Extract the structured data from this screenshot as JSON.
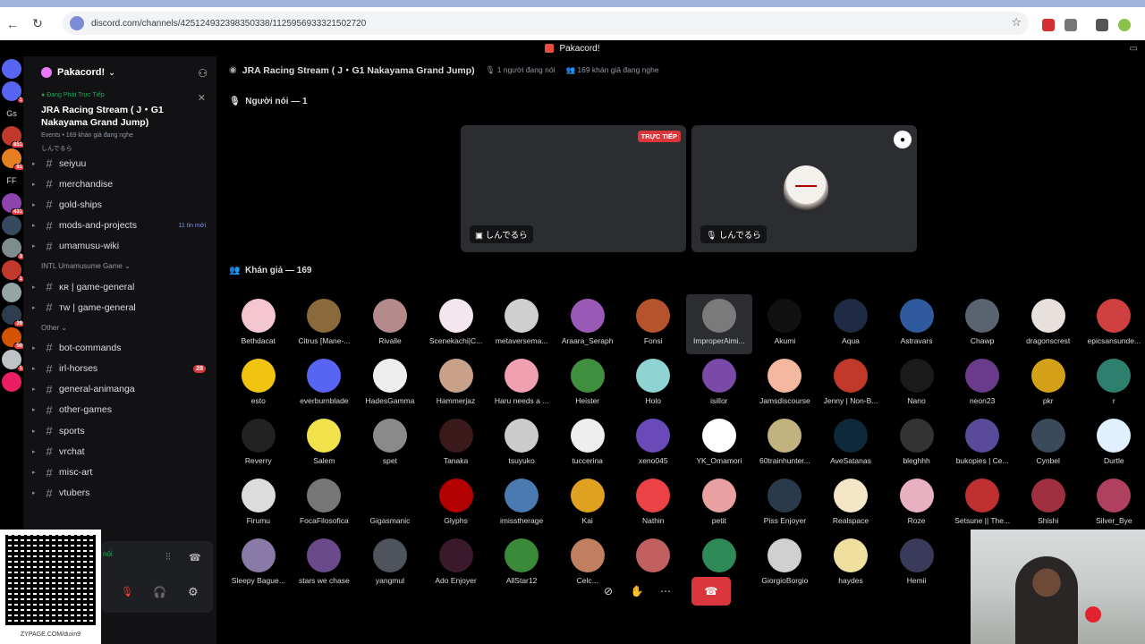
{
  "browser": {
    "url": "discord.com/channels/425124932398350338/1125956933321502720",
    "back_icon": "←",
    "reload_icon": "↻",
    "star_icon": "☆"
  },
  "window": {
    "title": "Pakacord!"
  },
  "guilds": [
    {
      "label": "",
      "color": "#5865f2",
      "badge": ""
    },
    {
      "label": "",
      "color": "#5865f2",
      "badge": "1"
    },
    {
      "label": "Gs",
      "color": "#000000",
      "badge": ""
    },
    {
      "label": "",
      "color": "#c0392b",
      "badge": "851"
    },
    {
      "label": "",
      "color": "#e67e22",
      "badge": "91"
    },
    {
      "label": "FF",
      "color": "#000000",
      "badge": ""
    },
    {
      "label": "",
      "color": "#8e44ad",
      "badge": "431"
    },
    {
      "label": "",
      "color": "#34495e",
      "badge": ""
    },
    {
      "label": "",
      "color": "#7f8c8d",
      "badge": "3"
    },
    {
      "label": "",
      "color": "#c0392b",
      "badge": "1"
    },
    {
      "label": "",
      "color": "#95a5a6",
      "badge": ""
    },
    {
      "label": "",
      "color": "#2c3e50",
      "badge": "39"
    },
    {
      "label": "",
      "color": "#d35400",
      "badge": "50"
    },
    {
      "label": "",
      "color": "#bdc3c7",
      "badge": "1"
    },
    {
      "label": "",
      "color": "#e91e63",
      "badge": ""
    }
  ],
  "server": {
    "name": "Pakacord!",
    "chevron": "⌄"
  },
  "live_event": {
    "label": "Đang Phát Trực Tiếp",
    "title": "JRA Racing Stream ( J・G1 Nakayama Grand Jump)",
    "meta": "Events • 169 khán giả đang nghe",
    "host": "しんでるら"
  },
  "channels_top": [
    {
      "name": "seiyuu",
      "badge": "",
      "badge_type": ""
    },
    {
      "name": "merchandise",
      "badge": "",
      "badge_type": ""
    },
    {
      "name": "gold-ships",
      "badge": "",
      "badge_type": ""
    },
    {
      "name": "mods-and-projects",
      "badge": "11 tin mới",
      "badge_type": "new"
    },
    {
      "name": "umamusu-wiki",
      "badge": "",
      "badge_type": ""
    }
  ],
  "category_intl": "INTL Umamusume Game",
  "channels_intl": [
    {
      "name": "ᴋʀ | game-general"
    },
    {
      "name": "ᴛᴡ | game-general"
    }
  ],
  "category_other": "Other",
  "channels_other": [
    {
      "name": "bot-commands",
      "badge": ""
    },
    {
      "name": "irl-horses",
      "badge": "28"
    },
    {
      "name": "general-animanga",
      "badge": ""
    },
    {
      "name": "other-games",
      "badge": ""
    },
    {
      "name": "sports",
      "badge": ""
    },
    {
      "name": "vrchat",
      "badge": ""
    },
    {
      "name": "misc-art",
      "badge": ""
    },
    {
      "name": "vtubers",
      "badge": ""
    }
  ],
  "user_panel": {
    "status": "nối"
  },
  "qr": {
    "caption": "ZYPAGE.COM/duxn9"
  },
  "stage": {
    "title": "JRA Racing Stream ( J・G1 Nakayama Grand Jump)",
    "speaking": "1 người đang nói",
    "listening": "169 khán giả đang nghe",
    "speakers_heading": "Người nói — 1",
    "audience_heading": "Khán giả — 169",
    "live_tag": "TRỰC TIẾP",
    "tiles": [
      {
        "name": "しんでるら"
      },
      {
        "name": "しんでるら"
      }
    ]
  },
  "audience": [
    [
      {
        "name": "Bethdacat",
        "color": "#f4c6d0"
      },
      {
        "name": "Citrus [Mane-...",
        "color": "#8a6a3a"
      },
      {
        "name": "Rivalle",
        "color": "#b48a8a"
      },
      {
        "name": "Scenekachi|C...",
        "color": "#f3e6ee"
      },
      {
        "name": "metaversema...",
        "color": "#cfcfcf"
      },
      {
        "name": "Araara_Seraph",
        "color": "#9b59b6"
      },
      {
        "name": "Fonsi",
        "color": "#b5542c"
      },
      {
        "name": "ImproperAimi...",
        "color": "#7a7a7a"
      },
      {
        "name": "Akumi",
        "color": "#111111"
      },
      {
        "name": "Aqua",
        "color": "#1f2a44"
      },
      {
        "name": "Astravars",
        "color": "#2f5a9e"
      },
      {
        "name": "Chawp",
        "color": "#5a6470"
      },
      {
        "name": "dragonscrest",
        "color": "#e8e0dc"
      },
      {
        "name": "epicsansunde...",
        "color": "#d04040"
      }
    ],
    [
      {
        "name": "esto",
        "color": "#f1c40f"
      },
      {
        "name": "everburnblade",
        "color": "#5865f2"
      },
      {
        "name": "HadesGamma",
        "color": "#eeeeee"
      },
      {
        "name": "Hammerjaz",
        "color": "#c9a08a"
      },
      {
        "name": "Haru needs a ...",
        "color": "#f0a0b0"
      },
      {
        "name": "Heister",
        "color": "#3f8f3f"
      },
      {
        "name": "Holo",
        "color": "#8fd3d3"
      },
      {
        "name": "isillor",
        "color": "#7b4aa8"
      },
      {
        "name": "Jamsdiscourse",
        "color": "#f4b7a0"
      },
      {
        "name": "Jenny | Non-B...",
        "color": "#c0392b"
      },
      {
        "name": "Nano",
        "color": "#1a1a1a"
      },
      {
        "name": "neon23",
        "color": "#6a3b8a"
      },
      {
        "name": "pkr",
        "color": "#d4a017"
      },
      {
        "name": "r",
        "color": "#2f7f6f"
      }
    ],
    [
      {
        "name": "Reverry",
        "color": "#222222"
      },
      {
        "name": "Salem",
        "color": "#f1e14a"
      },
      {
        "name": "spet",
        "color": "#8a8a8a"
      },
      {
        "name": "Tanaka",
        "color": "#3a1a1a"
      },
      {
        "name": "tsuyuko",
        "color": "#cccccc"
      },
      {
        "name": "tuccerina",
        "color": "#eeeeee"
      },
      {
        "name": "xeno045",
        "color": "#6a4ab8"
      },
      {
        "name": "YK_Omamori",
        "color": "#ffffff"
      },
      {
        "name": "60trainhunter...",
        "color": "#c2b280"
      },
      {
        "name": "AveSatanas",
        "color": "#0e2a3a"
      },
      {
        "name": "bleghhh",
        "color": "#333333"
      },
      {
        "name": "bukopies | Ce...",
        "color": "#5a4a9a"
      },
      {
        "name": "Cynbel",
        "color": "#3a4a5a"
      },
      {
        "name": "Durtle",
        "color": "#e0f0ff"
      }
    ],
    [
      {
        "name": "Firumu",
        "color": "#dcdcdc"
      },
      {
        "name": "FocaFilosofica",
        "color": "#777777"
      },
      {
        "name": "Gigasmanic",
        "color": "#000000"
      },
      {
        "name": "Glyphs",
        "color": "#b30000"
      },
      {
        "name": "imisstherage",
        "color": "#4a7ab0"
      },
      {
        "name": "Kai",
        "color": "#e0a020"
      },
      {
        "name": "Nathin",
        "color": "#ed4245"
      },
      {
        "name": "petit",
        "color": "#e8a0a0"
      },
      {
        "name": "Piss Enjoyer",
        "color": "#2a3a4a"
      },
      {
        "name": "Realspace",
        "color": "#f5e6c8"
      },
      {
        "name": "Roze",
        "color": "#e8b0c0"
      },
      {
        "name": "Setsune || The...",
        "color": "#c03030"
      },
      {
        "name": "Shishi",
        "color": "#a03040"
      },
      {
        "name": "Silver_Bye",
        "color": "#b04060"
      }
    ],
    [
      {
        "name": "Sleepy Bague...",
        "color": "#8a7aa8"
      },
      {
        "name": "stars we chase",
        "color": "#6a4a8a"
      },
      {
        "name": "yangmul",
        "color": "#4f545c"
      },
      {
        "name": "Ado Enjoyer",
        "color": "#3a1a2a"
      },
      {
        "name": "AllStar12",
        "color": "#3a8a3a"
      },
      {
        "name": "Celc...",
        "color": "#c08060"
      },
      {
        "name": "",
        "color": "#c06060"
      },
      {
        "name": "...",
        "color": "#2e8b57"
      },
      {
        "name": "GiorgioBorgio",
        "color": "#d0d0d0"
      },
      {
        "name": "haydes",
        "color": "#f0e0a0"
      },
      {
        "name": "Hemii",
        "color": "#3a3a5a"
      },
      {
        "name": "",
        "color": "#000000"
      },
      {
        "name": "",
        "color": "#000000"
      },
      {
        "name": "",
        "color": "#000000"
      }
    ]
  ],
  "colors": {
    "accent": "#5865f2",
    "danger": "#da373c",
    "live_green": "#23a55a"
  }
}
